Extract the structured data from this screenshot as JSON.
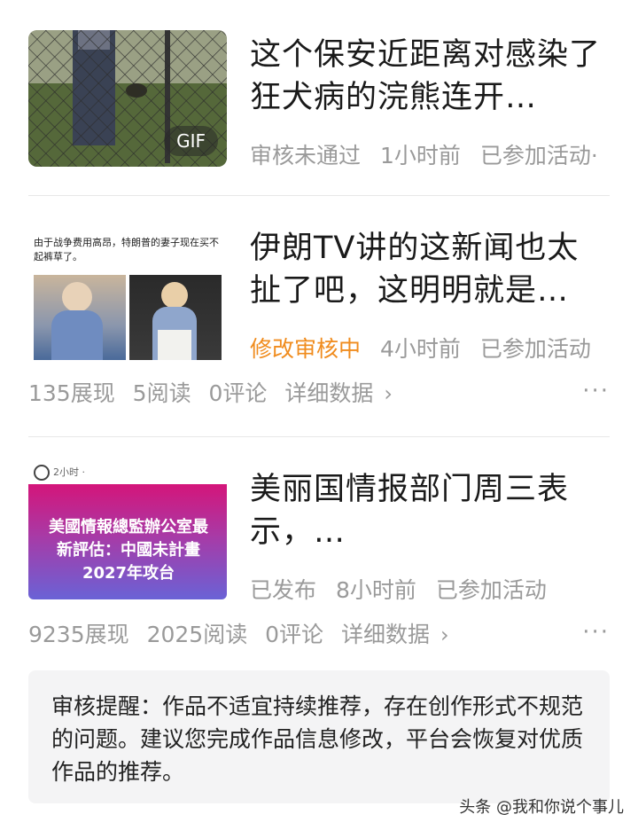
{
  "items": [
    {
      "title": "这个保安近距离对感染了狂犬病的浣熊连开…",
      "thumb_badge": "GIF",
      "status": "审核未通过",
      "time": "1小时前",
      "activity": "已参加活动·"
    },
    {
      "title": "伊朗TV讲的这新闻也太扯了吧，这明明就是…",
      "thumb_text": "由于战争费用高昂，特朗普的妻子现在买不起裤草了。",
      "status": "修改审核中",
      "time": "4小时前",
      "activity": "已参加活动",
      "stats": {
        "views": "135展现",
        "reads": "5阅读",
        "comments": "0评论",
        "details": "详细数据"
      }
    },
    {
      "title": "美丽国情报部门周三表示，…",
      "thumb_header": "2小时 · ",
      "thumb_text": "美國情報總監辦公室最新評估：中國未計畫2027年攻台",
      "status": "已发布",
      "time": "8小时前",
      "activity": "已参加活动",
      "stats": {
        "views": "9235展现",
        "reads": "2025阅读",
        "comments": "0评论",
        "details": "详细数据"
      }
    }
  ],
  "more_icon": "···",
  "chevron": "›",
  "notice": "审核提醒：作品不适宜持续推荐，存在创作形式不规范的问题。建议您完成作品信息修改，平台会恢复对优质作品的推荐。",
  "watermark": "头条 @我和你说个事儿",
  "colors": {
    "pending": "#f08c1e",
    "meta": "#9a9a9a",
    "notice_bg": "#f4f4f5",
    "thumb3_gradient": [
      "#d2127a",
      "#6b5bd0"
    ]
  }
}
